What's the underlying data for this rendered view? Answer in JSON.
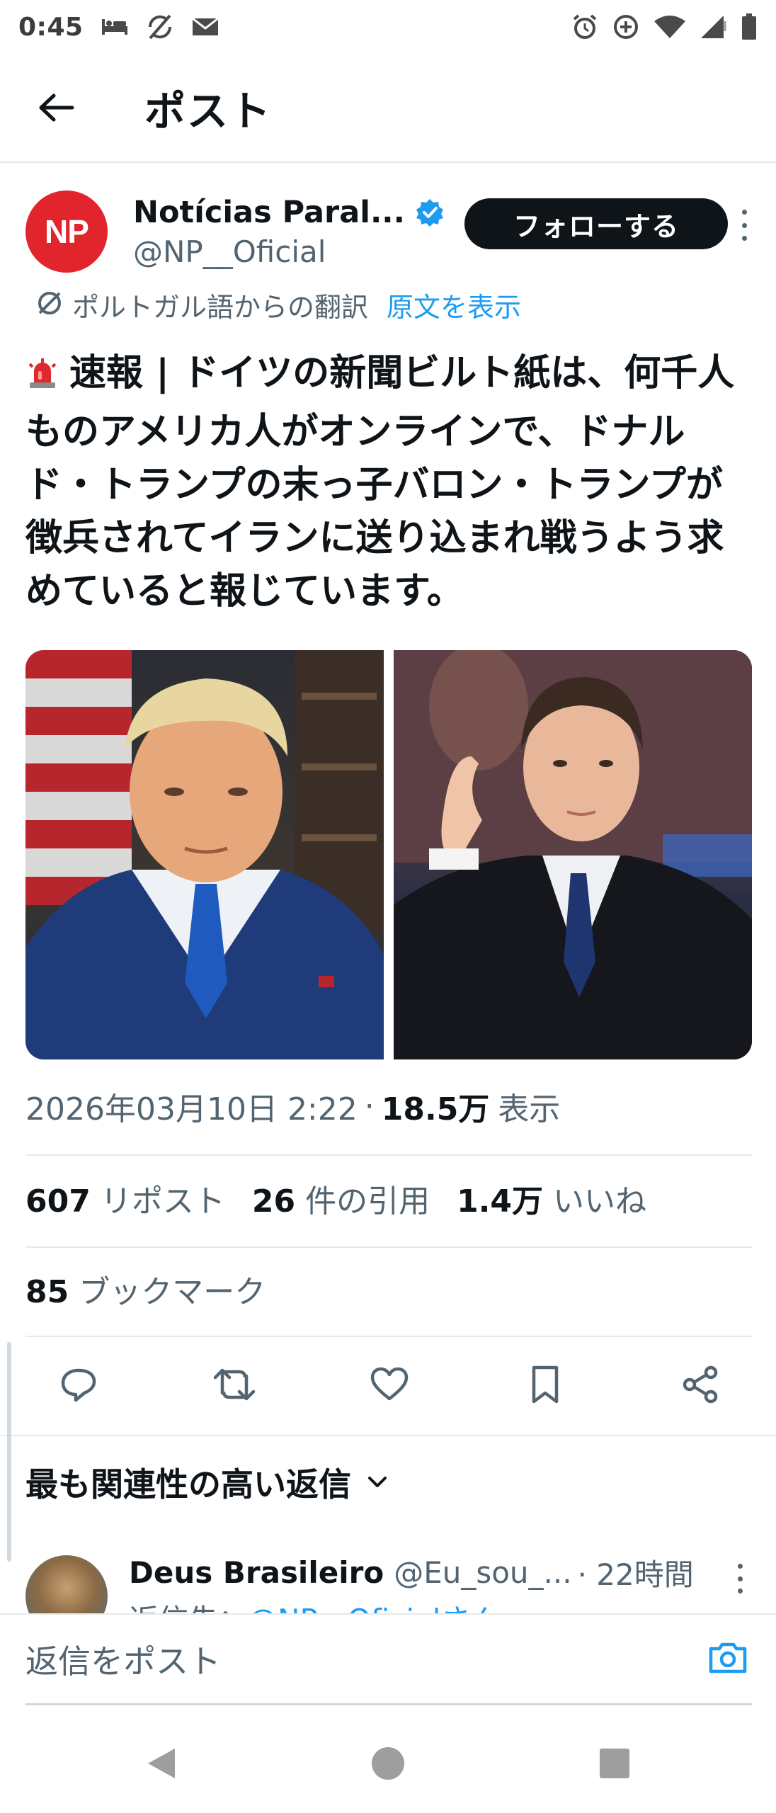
{
  "status_bar": {
    "time": "0:45"
  },
  "header": {
    "title": "ポスト"
  },
  "post": {
    "author": {
      "avatar_text": "NP",
      "name": "Notícias Paral...",
      "handle": "@NP__Oficial",
      "verified": true
    },
    "follow_label": "フォローする",
    "translation": {
      "label": "ポルトガル語からの翻訳",
      "show_original": "原文を表示"
    },
    "text": "速報 | ドイツの新聞ビルト紙は、何千人ものアメリカ人がオンラインで、ドナルド・トランプの末っ子バロン・トランプが徴兵されてイランに送り込まれ戦うよう求めていると報じています。",
    "timestamp": "2026年03月10日 2:22",
    "views": "18.5万",
    "views_label": "表示",
    "stats": {
      "reposts": "607",
      "reposts_label": "リポスト",
      "quotes": "26",
      "quotes_label": "件の引用",
      "likes": "1.4万",
      "likes_label": "いいね",
      "bookmarks": "85",
      "bookmarks_label": "ブックマーク"
    }
  },
  "replies": {
    "sort_label": "最も関連性の高い返信",
    "items": [
      {
        "name": "Deus Brasileiro",
        "handle": "@Eu_sou_...",
        "time": "· 22時間",
        "reply_to_prefix": "返信先：",
        "reply_to": "@NP__Oficialさん"
      }
    ]
  },
  "compose": {
    "placeholder": "返信をポスト"
  },
  "colors": {
    "accent": "#1d9bf0",
    "avatar_bg": "#e2242c",
    "text_primary": "#0f1419",
    "text_secondary": "#536471"
  }
}
